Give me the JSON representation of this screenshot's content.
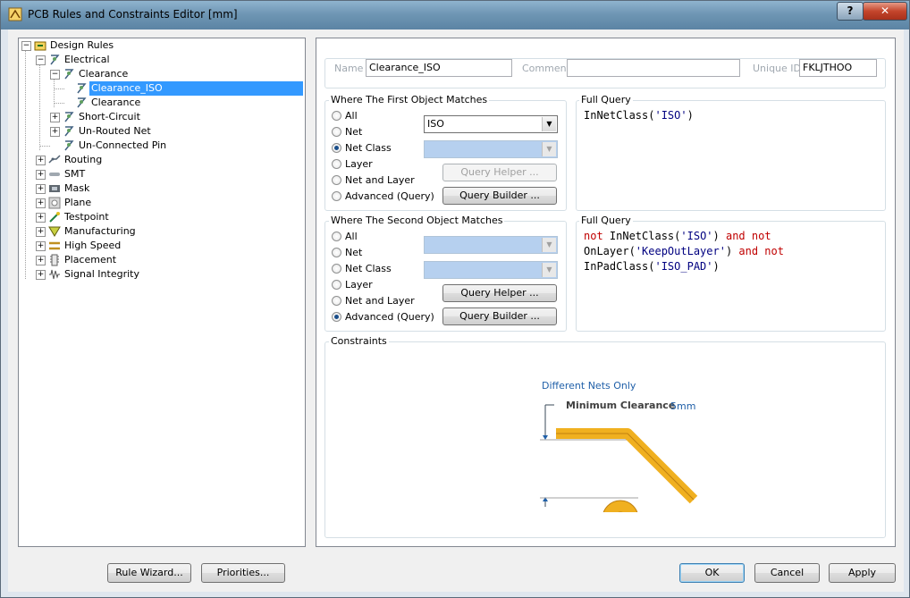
{
  "window": {
    "title": "PCB Rules and Constraints Editor [mm]",
    "help_label": "?",
    "close_label": "✕"
  },
  "tree": {
    "items": [
      {
        "label": "Design Rules"
      },
      {
        "label": "Electrical"
      },
      {
        "label": "Clearance"
      },
      {
        "label": "Clearance_ISO"
      },
      {
        "label": "Clearance"
      },
      {
        "label": "Short-Circuit"
      },
      {
        "label": "Un-Routed Net"
      },
      {
        "label": "Un-Connected Pin"
      },
      {
        "label": "Routing"
      },
      {
        "label": "SMT"
      },
      {
        "label": "Mask"
      },
      {
        "label": "Plane"
      },
      {
        "label": "Testpoint"
      },
      {
        "label": "Manufacturing"
      },
      {
        "label": "High Speed"
      },
      {
        "label": "Placement"
      },
      {
        "label": "Signal Integrity"
      }
    ]
  },
  "rule": {
    "name_label": "Name",
    "name_value": "Clearance_ISO",
    "comment_label": "Comment",
    "comment_value": "",
    "uid_label": "Unique ID",
    "uid_value": "FKLJTHOO"
  },
  "first": {
    "title": "Where The First Object Matches",
    "options": [
      "All",
      "Net",
      "Net Class",
      "Layer",
      "Net and Layer",
      "Advanced (Query)"
    ],
    "selected": "Net Class",
    "combo_value": "ISO",
    "query_helper": "Query Helper ...",
    "query_builder": "Query Builder ...",
    "full_query_title": "Full Query",
    "query_fn": "InNetClass(",
    "query_arg": "'ISO'",
    "query_close": ")"
  },
  "second": {
    "title": "Where The Second Object Matches",
    "options": [
      "All",
      "Net",
      "Net Class",
      "Layer",
      "Net and Layer",
      "Advanced (Query)"
    ],
    "selected": "Advanced (Query)",
    "query_helper": "Query Helper ...",
    "query_builder": "Query Builder ...",
    "full_query_title": "Full Query",
    "q": {
      "not1": "not",
      "fn1": " InNetClass(",
      "arg1": "'ISO'",
      "close1": ") ",
      "and1": "and not",
      "fn2": "OnLayer(",
      "arg2": "'KeepOutLayer'",
      "close2": ") ",
      "and2": "and not",
      "fn3": "InPadClass(",
      "arg3": "'ISO_PAD'",
      "close3": ")"
    }
  },
  "constraints": {
    "title": "Constraints",
    "diff_nets": "Different Nets Only",
    "min_clear_label": "Minimum Clearance",
    "min_clear_value": "5mm"
  },
  "footer": {
    "rule_wizard": "Rule Wizard...",
    "priorities": "Priorities...",
    "ok": "OK",
    "cancel": "Cancel",
    "apply": "Apply"
  },
  "colors": {
    "trace": "#f0b020",
    "accent": "#3399ff",
    "keyword": "#c00000",
    "string": "#000080",
    "blue_text": "#1f5fa8"
  }
}
